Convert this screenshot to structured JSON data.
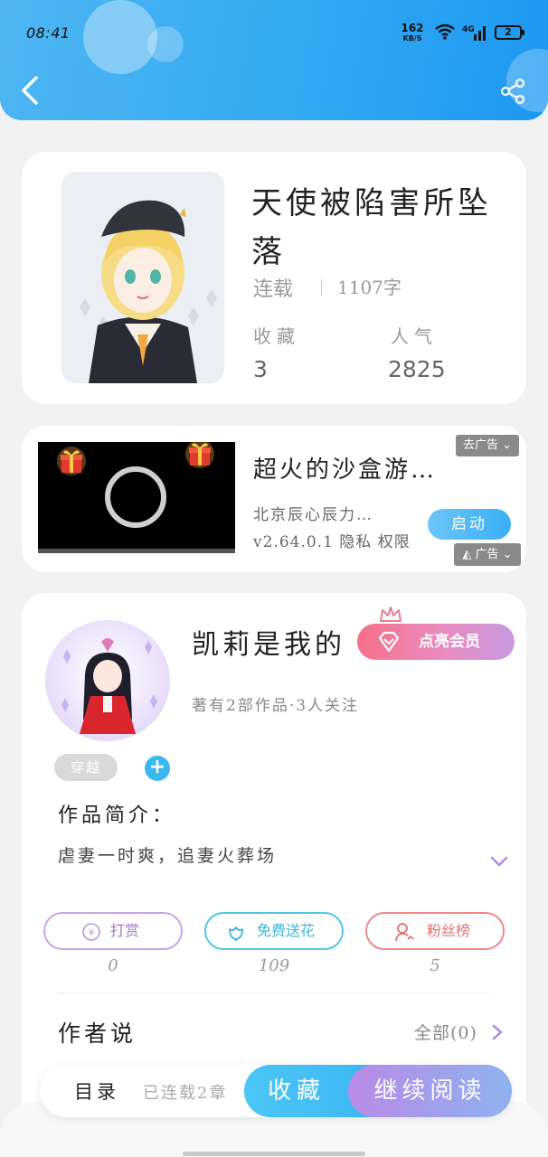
{
  "statusbar": {
    "time": "08:41",
    "net_speed": "162",
    "net_unit": "KB/S",
    "signal": "4G",
    "battery": "2"
  },
  "book": {
    "title": "天使被陷害所坠落",
    "status": "连载",
    "word_count": "1107字",
    "favorites_label": "收藏",
    "favorites_value": "3",
    "popularity_label": "人气",
    "popularity_value": "2825"
  },
  "ad": {
    "title": "超火的沙盒游…",
    "remove_label": "去广告",
    "company": "北京辰心辰力…",
    "meta": "v2.64.0.1 隐私 权限",
    "button_label": "启动",
    "ad_label": "广告"
  },
  "author": {
    "name": "凯莉是我的",
    "vip_label": "点亮会员",
    "stats": "著有2部作品·3人关注",
    "tag": "穿越",
    "intro_heading": "作品简介：",
    "intro_text": "虐妻一时爽，追妻火葬场"
  },
  "actions": {
    "tip_label": "打赏",
    "tip_count": "0",
    "flower_label": "免费送花",
    "flower_count": "109",
    "fans_label": "粉丝榜",
    "fans_count": "5"
  },
  "author_words": {
    "heading": "作者说",
    "all_link": "全部(0)"
  },
  "bottom_bar": {
    "toc_label": "目录",
    "chapter_status": "已连载2章",
    "collect_label": "收藏",
    "read_label": "继续阅读"
  },
  "colors": {
    "header_blue": "#33a9f2",
    "vip_pink": "#f5708a",
    "read_purple": "#b88ae6"
  },
  "icons": [
    "back-arrow-icon",
    "share-icon",
    "wifi-icon",
    "signal-icon",
    "battery-icon",
    "gift-icon",
    "crown-icon",
    "diamond-icon",
    "coin-icon",
    "flower-icon",
    "person-icon",
    "chevron-down-icon",
    "chevron-right-icon"
  ]
}
